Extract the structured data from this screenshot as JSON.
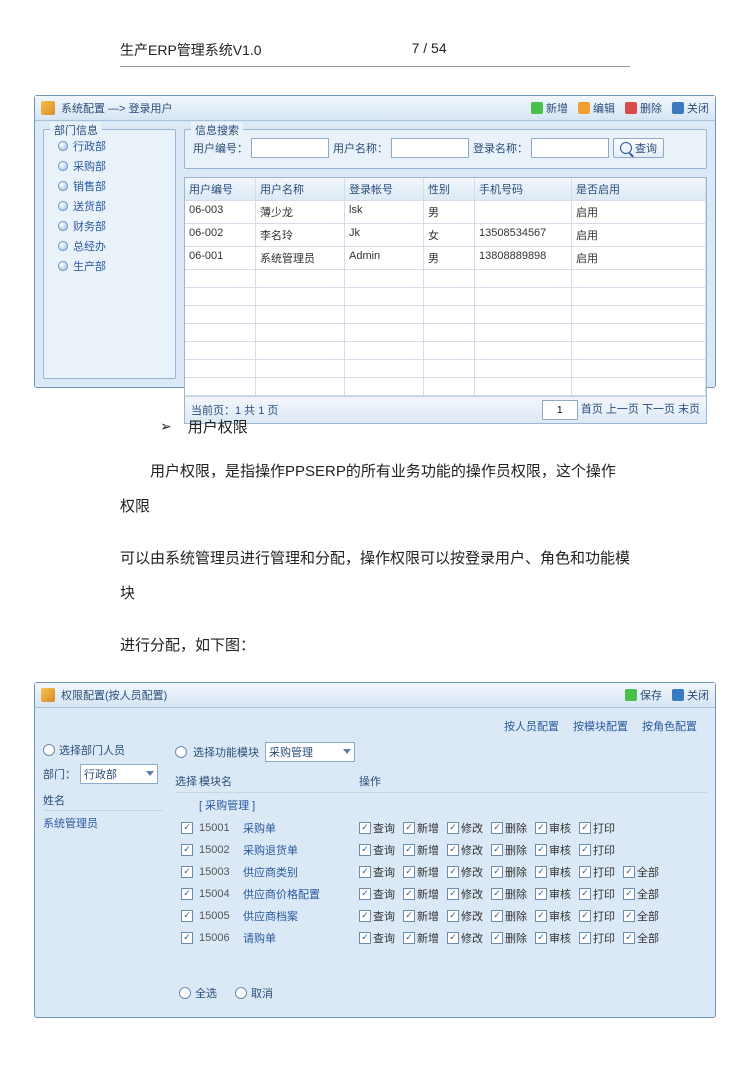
{
  "doc": {
    "title": "生产ERP管理系统V1.0",
    "page": "7 / 54",
    "section_bullet": "用户权限",
    "para1": "用户权限，是指操作PPSERP的所有业务功能的操作员权限，这个操作权限",
    "para2_pre": "可以由系统管理员进行管理和分配，操作权限可以按登录用户、角色和功能模块",
    "para3": "进行分配，如下图："
  },
  "win1": {
    "title": "系统配置 —> 登录用户",
    "btn_add": "新增",
    "btn_edit": "编辑",
    "btn_del": "删除",
    "btn_close": "关闭",
    "dept_group": "部门信息",
    "depts": [
      "行政部",
      "采购部",
      "销售部",
      "送货部",
      "财务部",
      "总经办",
      "生产部"
    ],
    "search_group": "信息搜索",
    "lbl_user_no": "用户编号：",
    "lbl_user_name": "用户名称：",
    "lbl_login_name": "登录名称：",
    "btn_search": "查询",
    "columns": [
      "用户编号",
      "用户名称",
      "登录帐号",
      "性别",
      "手机号码",
      "是否启用"
    ],
    "rows": [
      {
        "c": [
          "06-003",
          "薄少龙",
          "lsk",
          "男",
          "",
          "启用"
        ]
      },
      {
        "c": [
          "06-002",
          "李名玲",
          "Jk",
          "女",
          "13508534567",
          "启用"
        ]
      },
      {
        "c": [
          "06-001",
          "系统管理员",
          "Admin",
          "男",
          "13808889898",
          "启用"
        ]
      }
    ],
    "footer_left": "当前页：1 共 1 页",
    "footer_nav": "首页 上一页 下一页 末页",
    "pager_value": "1"
  },
  "win2": {
    "title": "权限配置(按人员配置)",
    "btn_save": "保存",
    "btn_close": "关闭",
    "tab1": "按人员配置",
    "tab2": "按模块配置",
    "tab3": "按角色配置",
    "radio_dept": "选择部门人员",
    "lbl_dept": "部门：",
    "dept_value": "行政部",
    "name_header": "姓名",
    "name_item": "系统管理员",
    "radio_module": "选择功能模块",
    "module_value": "采购管理",
    "col_sel": "选择",
    "col_mod": "模块名",
    "col_ops": "操作",
    "group": "[ 采购管理 ]",
    "modules": [
      {
        "code": "15001",
        "name": "采购单",
        "ops": [
          "查询",
          "新增",
          "修改",
          "删除",
          "审核",
          "打印"
        ]
      },
      {
        "code": "15002",
        "name": "采购退货单",
        "ops": [
          "查询",
          "新增",
          "修改",
          "删除",
          "审核",
          "打印"
        ]
      },
      {
        "code": "15003",
        "name": "供应商类别",
        "ops": [
          "查询",
          "新增",
          "修改",
          "删除",
          "审核",
          "打印",
          "全部"
        ]
      },
      {
        "code": "15004",
        "name": "供应商价格配置",
        "ops": [
          "查询",
          "新增",
          "修改",
          "删除",
          "审核",
          "打印",
          "全部"
        ]
      },
      {
        "code": "15005",
        "name": "供应商档案",
        "ops": [
          "查询",
          "新增",
          "修改",
          "删除",
          "审核",
          "打印",
          "全部"
        ]
      },
      {
        "code": "15006",
        "name": "请购单",
        "ops": [
          "查询",
          "新增",
          "修改",
          "删除",
          "审核",
          "打印",
          "全部"
        ]
      }
    ],
    "bottom_all": "全选",
    "bottom_clear": "取消"
  }
}
